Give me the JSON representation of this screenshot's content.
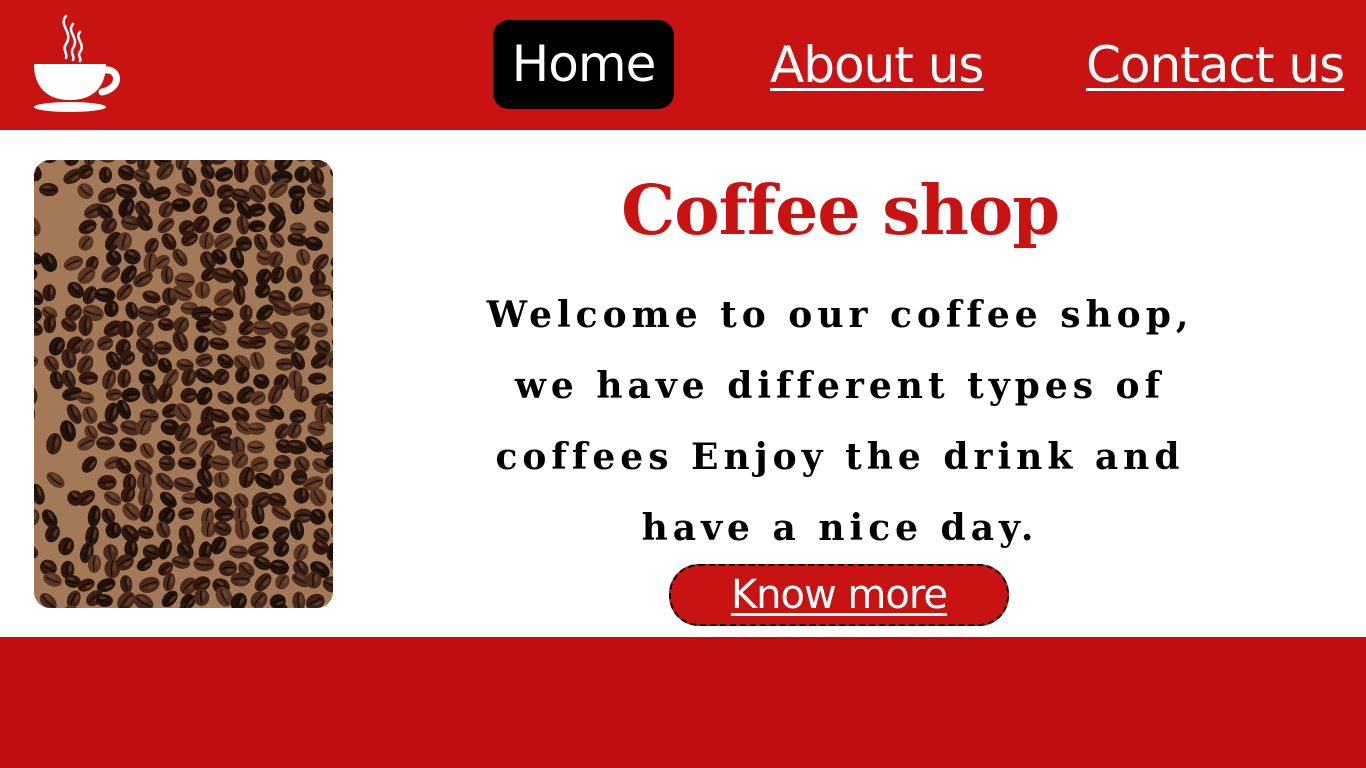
{
  "colors": {
    "brand_red": "#c91313",
    "footer_red": "#c10d0d",
    "nav_active_bg": "#000000",
    "text_light": "#ffffff",
    "text_dark": "#000000"
  },
  "header": {
    "logo_icon": "coffee-cup-icon",
    "nav": [
      {
        "label": "Home",
        "active": true
      },
      {
        "label": "About us",
        "active": false
      },
      {
        "label": "Contact us",
        "active": false
      }
    ]
  },
  "main": {
    "image_icon": "coffee-beans-image",
    "title": "Coffee shop",
    "welcome_lines": [
      "Welcome to our coffee shop,",
      "we have different types of",
      "coffees  Enjoy the drink and",
      "have a nice day."
    ],
    "cta_label": "Know more"
  }
}
